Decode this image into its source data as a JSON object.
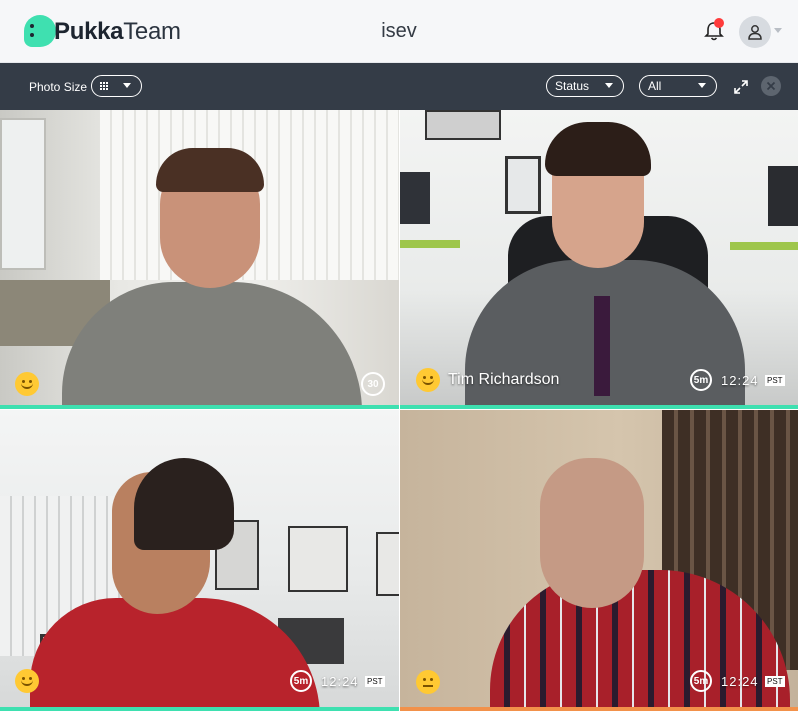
{
  "header": {
    "logo_pukka": "Pukka",
    "logo_team": "Team",
    "title": "isev"
  },
  "toolbar": {
    "photo_size_label": "Photo Size",
    "status_label": "Status",
    "filter_label": "All"
  },
  "tiles": [
    {
      "name": "",
      "timer": "30",
      "time": "",
      "tz": "",
      "mood": "happy",
      "bar_color": "#3ee0b0"
    },
    {
      "name": "Tim Richardson",
      "timer": "5m",
      "time": "12:24",
      "tz": "PST",
      "mood": "happy",
      "bar_color": "#3ee0b0"
    },
    {
      "name": "",
      "timer": "5m",
      "time": "12:24",
      "tz": "PST",
      "mood": "happy",
      "bar_color": "#3ee0b0"
    },
    {
      "name": "",
      "timer": "5m",
      "time": "12:24",
      "tz": "PST",
      "mood": "neutral",
      "bar_color": "#f2914a"
    }
  ],
  "icons": [
    "pukka-logo-icon",
    "bell-icon",
    "user-icon",
    "grid-icon",
    "expand-icon",
    "close-icon",
    "timer-icon",
    "smiley-icon"
  ]
}
